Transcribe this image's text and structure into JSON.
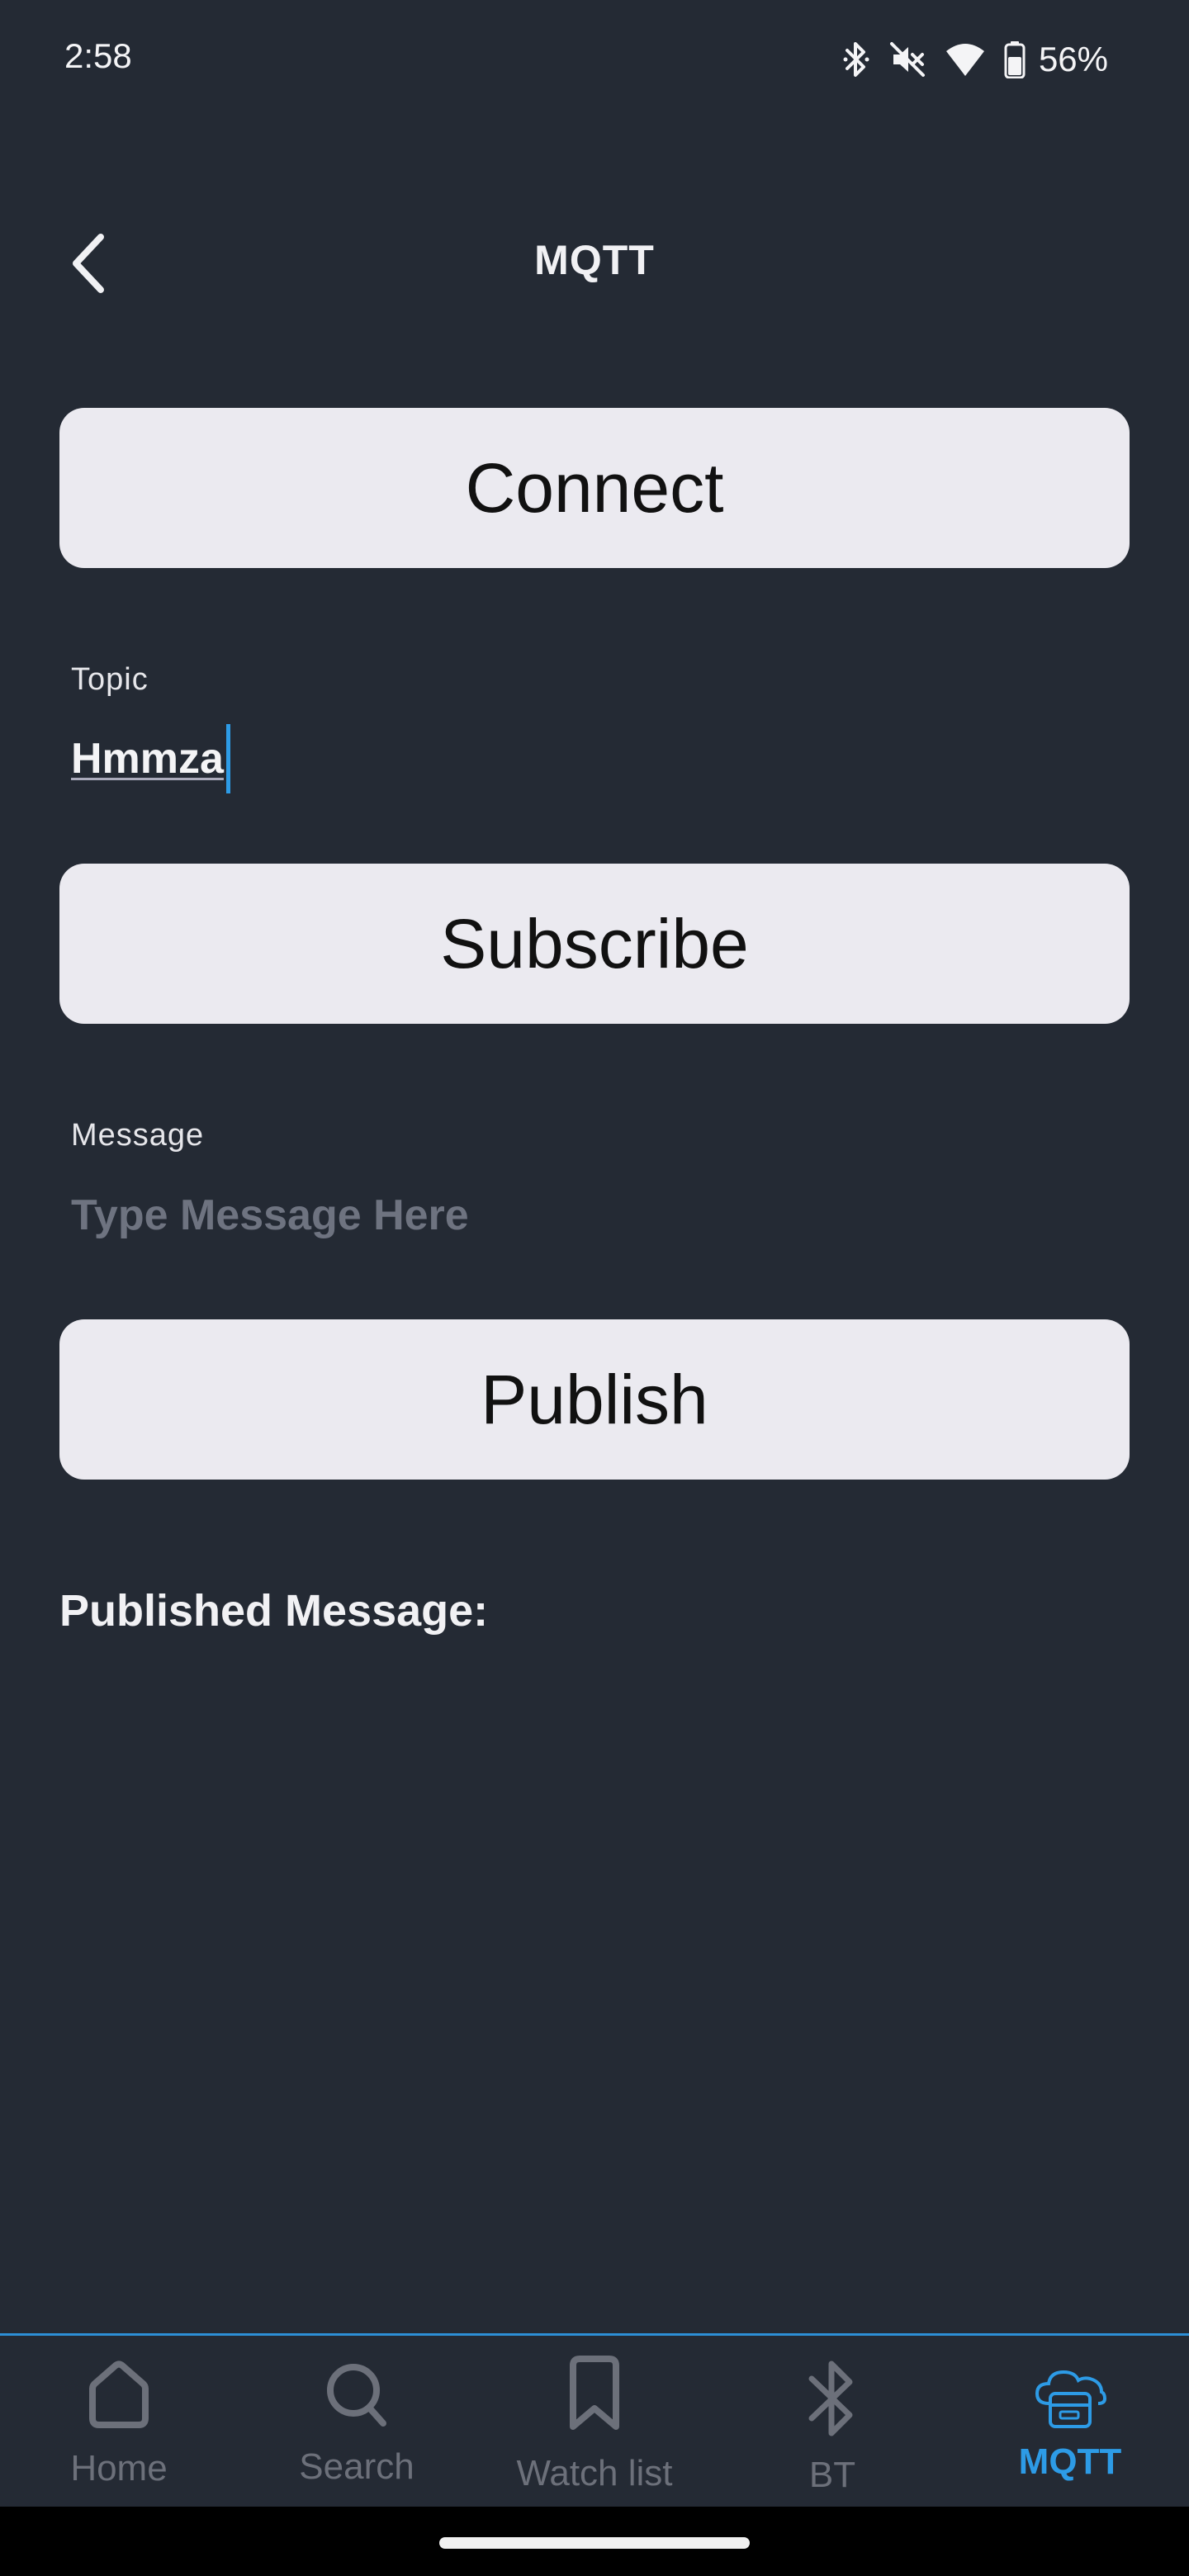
{
  "status_bar": {
    "time": "2:58",
    "battery": "56%",
    "icons": [
      "bluetooth-icon",
      "mute-icon",
      "wifi-icon",
      "battery-icon"
    ]
  },
  "header": {
    "title": "MQTT",
    "back_icon": "chevron-left-icon"
  },
  "buttons": {
    "connect": "Connect",
    "subscribe": "Subscribe",
    "publish": "Publish"
  },
  "topic": {
    "label": "Topic",
    "value": "Hmmza"
  },
  "message": {
    "label": "Message",
    "placeholder": "Type Message Here"
  },
  "published": {
    "label": "Published Message:"
  },
  "bottom_nav": {
    "items": [
      {
        "label": "Home",
        "icon": "home-icon"
      },
      {
        "label": "Search",
        "icon": "search-icon"
      },
      {
        "label": "Watch list",
        "icon": "bookmark-icon"
      },
      {
        "label": "BT",
        "icon": "bluetooth-icon"
      },
      {
        "label": "MQTT",
        "icon": "cloud-server-icon"
      }
    ],
    "active": "MQTT"
  },
  "colors": {
    "background": "#242a34",
    "button": "#ebeaf0",
    "accent": "#2d9be6",
    "inactive_nav": "#6c707a"
  }
}
